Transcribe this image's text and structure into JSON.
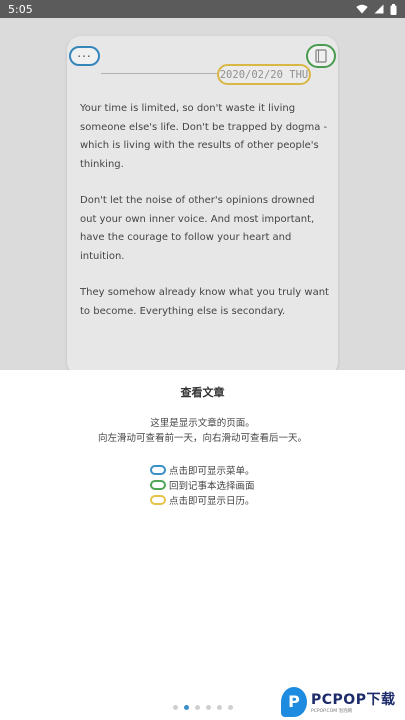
{
  "status_bar": {
    "time": "5:05"
  },
  "card": {
    "date": "2020/02/20 THU",
    "paragraphs": [
      "Your time is limited, so don't waste it living someone else's life. Don't be trapped by dogma - which is living with the results of other people's thinking.",
      "Don't let the noise of other's opinions drowned out your own inner voice. And most important, have the courage to follow your heart and intuition.",
      "They somehow already know what you truly want to become. Everything else is secondary."
    ]
  },
  "sheet": {
    "title": "查看文章",
    "desc_line1": "这里是显示文章的页面。",
    "desc_line2": "向左滑动可查看前一天，向右滑动可查看后一天。",
    "legend": [
      {
        "label": "点击即可显示菜单。",
        "color": "#3a8fc8"
      },
      {
        "label": "回到记事本选择画面",
        "color": "#4fa556"
      },
      {
        "label": "点击即可显示日历。",
        "color": "#e6c34b"
      }
    ]
  },
  "pager": {
    "count": 6,
    "active": 1
  },
  "watermark": {
    "brand": "PCPOP下载",
    "tagline": "PCPOP.COM 泡泡网"
  },
  "icons": [
    "wifi-icon",
    "signal-icon",
    "battery-icon",
    "more-icon",
    "notebook-icon"
  ]
}
